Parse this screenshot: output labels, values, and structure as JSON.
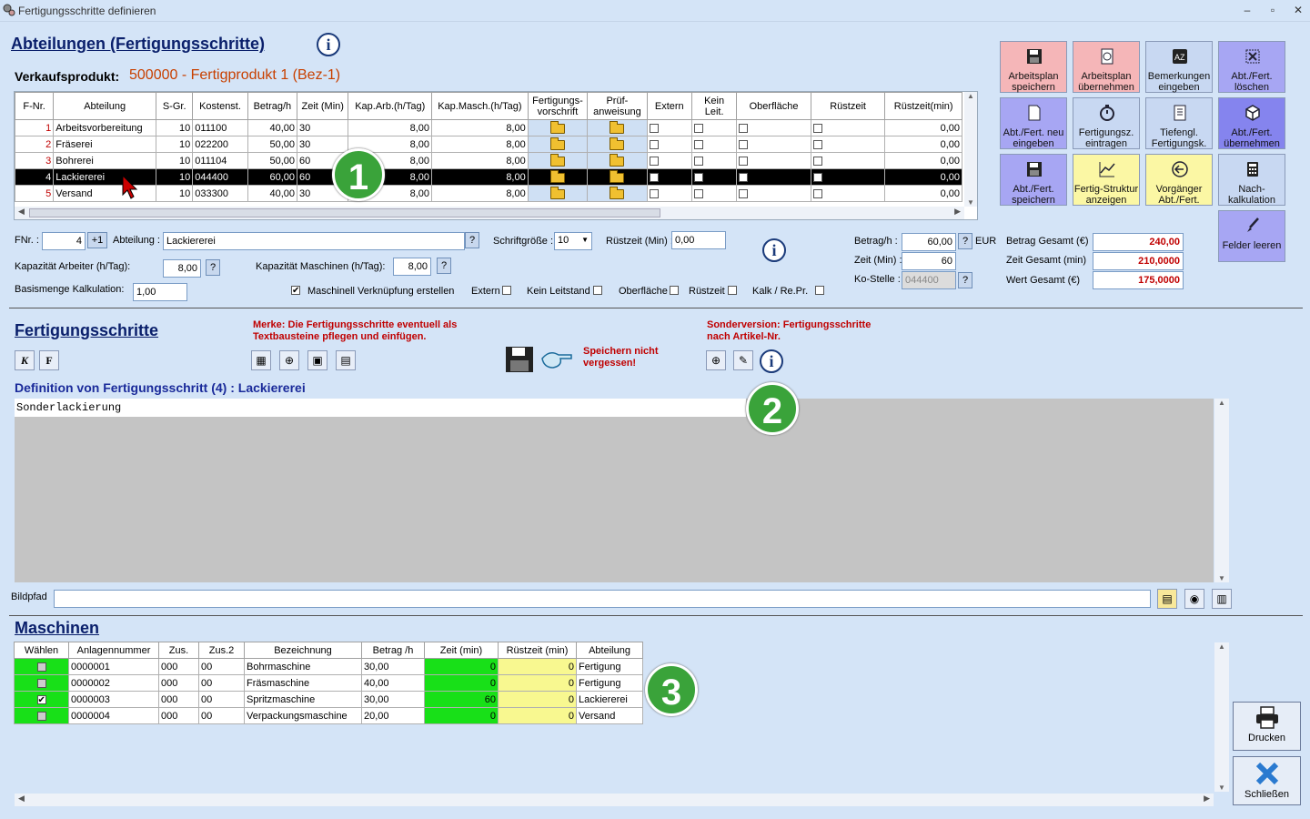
{
  "window": {
    "title": "Fertigungsschritte definieren"
  },
  "header": {
    "title": "Abteilungen (Fertigungsschritte)",
    "product_label": "Verkaufsprodukt:",
    "product_value": "500000 - Fertigprodukt 1  (Bez-1)"
  },
  "dept_table": {
    "columns": [
      "F-Nr.",
      "Abteilung",
      "S-Gr.",
      "Kostenst.",
      "Betrag/h",
      "Zeit (Min)",
      "Kap.Arb.(h/Tag)",
      "Kap.Masch.(h/Tag)",
      "Fertigungs-vorschrift",
      "Prüf-anweisung",
      "Extern",
      "Kein Leit.",
      "Oberfläche",
      "Rüstzeit",
      "Rüstzeit(min)"
    ],
    "rows": [
      {
        "nr": "1",
        "abteilung": "Arbeitsvorbereitung",
        "sgr": "10",
        "kst": "011100",
        "betrag": "40,00",
        "zeit": "30",
        "kaparb": "8,00",
        "kapmasch": "8,00",
        "ruest": "0,00"
      },
      {
        "nr": "2",
        "abteilung": "Fräserei",
        "sgr": "10",
        "kst": "022200",
        "betrag": "50,00",
        "zeit": "30",
        "kaparb": "8,00",
        "kapmasch": "8,00",
        "ruest": "0,00"
      },
      {
        "nr": "3",
        "abteilung": "Bohrerei",
        "sgr": "10",
        "kst": "011104",
        "betrag": "50,00",
        "zeit": "60",
        "kaparb": "8,00",
        "kapmasch": "8,00",
        "ruest": "0,00"
      },
      {
        "nr": "4",
        "abteilung": "Lackiererei",
        "sgr": "10",
        "kst": "044400",
        "betrag": "60,00",
        "zeit": "60",
        "kaparb": "8,00",
        "kapmasch": "8,00",
        "ruest": "0,00"
      },
      {
        "nr": "5",
        "abteilung": "Versand",
        "sgr": "10",
        "kst": "033300",
        "betrag": "40,00",
        "zeit": "30",
        "kaparb": "8,00",
        "kapmasch": "8,00",
        "ruest": "0,00"
      }
    ]
  },
  "callouts": {
    "one": "1",
    "two": "2",
    "three": "3"
  },
  "form": {
    "fnr_label": "FNr. :",
    "fnr_value": "4",
    "plus_label": "+1",
    "abteilung_label": "Abteilung :",
    "abteilung_value": "Lackiererei",
    "schrift_label": "Schriftgröße :",
    "schrift_value": "10",
    "ruestzeit_label": "Rüstzeit (Min) :",
    "ruestzeit_value": "0,00",
    "kaparb_label": "Kapazität Arbeiter (h/Tag):",
    "kaparb_value": "8,00",
    "kapmasch_label": "Kapazität Maschinen (h/Tag):",
    "kapmasch_value": "8,00",
    "basis_label": "Basismenge Kalkulation:",
    "basis_value": "1,00",
    "maschinell_label": "Maschinell Verknüpfung erstellen",
    "extern_label": "Extern",
    "keinleit_label": "Kein Leitstand",
    "oberflaeche_label": "Oberfläche",
    "ruest_cb_label": "Rüstzeit",
    "kalk_label": "Kalk / Re.Pr.",
    "betrag_label": "Betrag/h :",
    "betrag_value": "60,00",
    "eur": "EUR",
    "zeit_label": "Zeit (Min) :",
    "zeit_value": "60",
    "kostelle_label": "Ko-Stelle :",
    "kostelle_value": "044400",
    "betrag_gesamt_label": "Betrag Gesamt (€)",
    "betrag_gesamt_value": "240,00",
    "zeit_gesamt_label": "Zeit Gesamt (min)",
    "zeit_gesamt_value": "210,0000",
    "wert_gesamt_label": "Wert Gesamt (€)",
    "wert_gesamt_value": "175,0000",
    "q": "?"
  },
  "buttons": {
    "arbeitsplan_speichern": "Arbeitsplan speichern",
    "arbeitsplan_uebernehmen": "Arbeitsplan übernehmen",
    "bemerkungen": "Bemerkungen eingeben",
    "abt_loeschen": "Abt./Fert. löschen",
    "abt_neu": "Abt./Fert. neu eingeben",
    "fertigungsz": "Fertigungsz. eintragen",
    "tiefengl": "Tiefengl. Fertigungsk.",
    "abt_uebernehmen": "Abt./Fert. übernehmen",
    "abt_speichern": "Abt./Fert. speichern",
    "struktur": "Fertig-Struktur anzeigen",
    "vorgaenger": "Vorgänger Abt./Fert.",
    "nachkalk": "Nach- kalkulation",
    "felder_leeren": "Felder leeren",
    "drucken": "Drucken",
    "schliessen": "Schließen"
  },
  "steps": {
    "title": "Fertigungsschritte",
    "merke": "Merke: Die Fertigungsschritte eventuell als Textbausteine pflegen und einfügen.",
    "sonder": "Sonderversion: Fertigungsschritte nach Artikel-Nr.",
    "save_hint": "Speichern nicht vergessen!",
    "k": "K",
    "f": "F",
    "definition": "Definition von Fertigungsschritt (4) : Lackiererei",
    "text": "Sonderlackierung",
    "bildpfad_label": "Bildpfad"
  },
  "machines": {
    "title": "Maschinen",
    "columns": [
      "Wählen",
      "Anlagennummer",
      "Zus.",
      "Zus.2",
      "Bezeichnung",
      "Betrag /h",
      "Zeit (min)",
      "Rüstzeit (min)",
      "Abteilung"
    ],
    "rows": [
      {
        "nr": "0000001",
        "zus": "000",
        "zus2": "00",
        "bez": "Bohrmaschine",
        "betrag": "30,00",
        "zeit": "0",
        "ruest": "0",
        "abt": "Fertigung",
        "checked": false
      },
      {
        "nr": "0000002",
        "zus": "000",
        "zus2": "00",
        "bez": "Fräsmaschine",
        "betrag": "40,00",
        "zeit": "0",
        "ruest": "0",
        "abt": "Fertigung",
        "checked": false
      },
      {
        "nr": "0000003",
        "zus": "000",
        "zus2": "00",
        "bez": "Spritzmaschine",
        "betrag": "30,00",
        "zeit": "60",
        "ruest": "0",
        "abt": "Lackiererei",
        "checked": true
      },
      {
        "nr": "0000004",
        "zus": "000",
        "zus2": "00",
        "bez": "Verpackungsmaschine",
        "betrag": "20,00",
        "zeit": "0",
        "ruest": "0",
        "abt": "Versand",
        "checked": false
      }
    ]
  },
  "colors": {
    "accent_green": "#3aa33a",
    "sel_row": "#000000",
    "red_text": "#c00000",
    "heading_blue": "#0a1f6b"
  }
}
